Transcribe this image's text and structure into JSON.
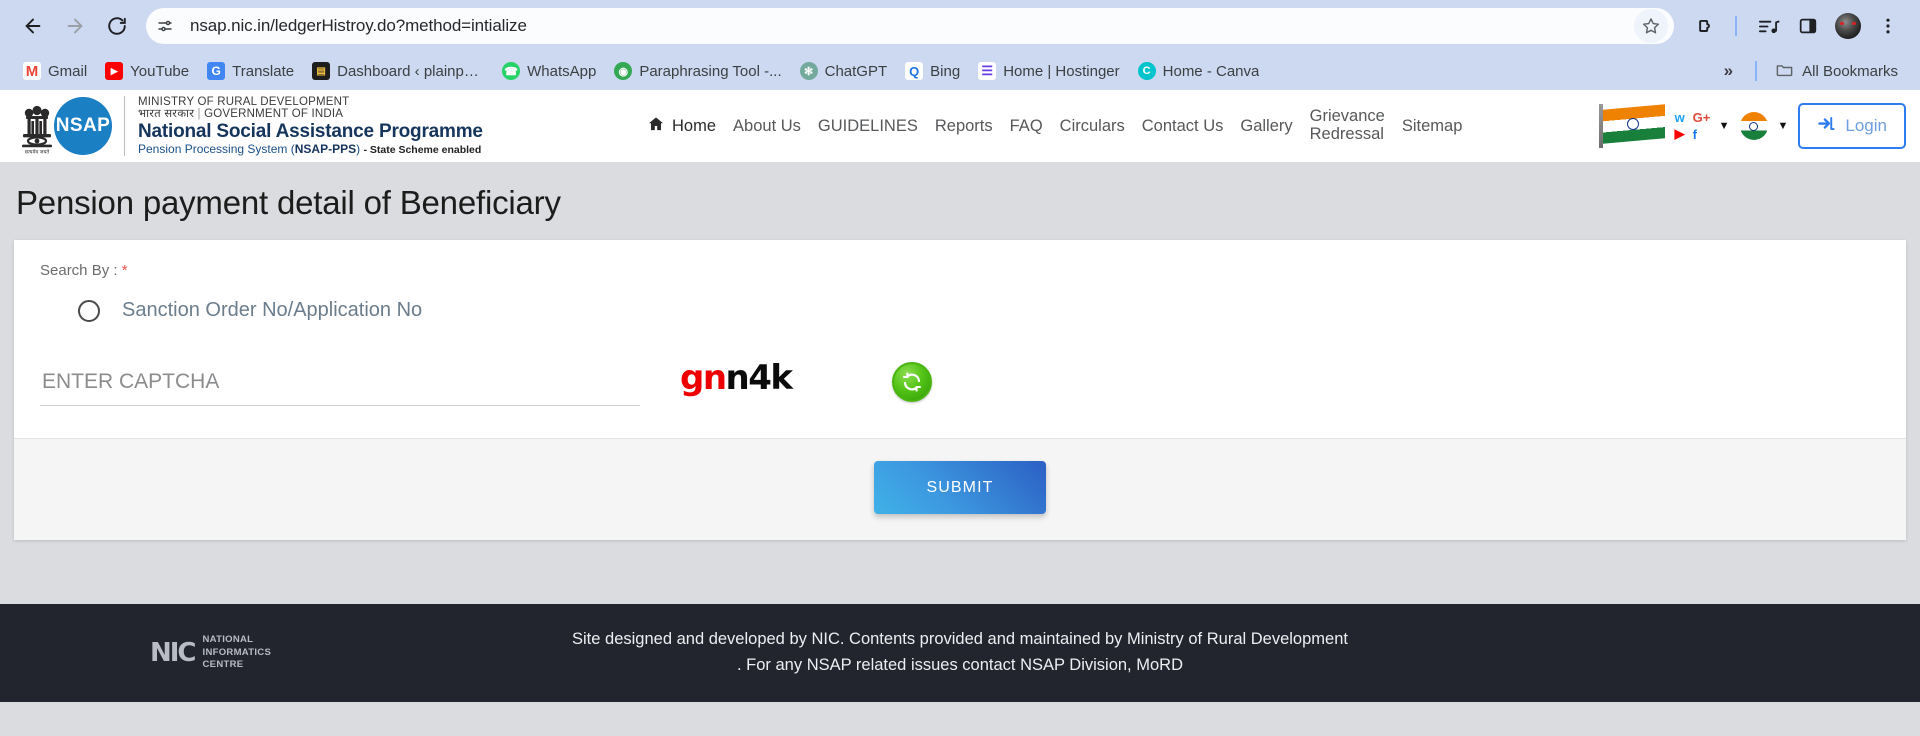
{
  "browser": {
    "back_label": "Back",
    "forward_label": "Forward",
    "reload_label": "Reload",
    "site_info_icon": "tune-icon",
    "url": "nsap.nic.in/ledgerHistroy.do?method=intialize",
    "star_icon": "star-icon",
    "extensions_icon": "extensions-puzzle-icon",
    "media_icon": "media-playlist-icon",
    "side_panel_icon": "side-panel-icon",
    "profile_icon": "profile-avatar",
    "menu_icon": "three-dot-menu-icon",
    "bookmarks": [
      {
        "label": "Gmail",
        "icon": "gmail-icon",
        "glyph": "M",
        "color": "#ea4335",
        "bg": "#ffffff"
      },
      {
        "label": "YouTube",
        "icon": "youtube-icon",
        "glyph": "▶",
        "color": "#ffffff",
        "bg": "#ff0000"
      },
      {
        "label": "Translate",
        "icon": "google-translate-icon",
        "glyph": "G",
        "color": "#ffffff",
        "bg": "#4285f4"
      },
      {
        "label": "Dashboard ‹ plainpa...",
        "icon": "wordpress-dashboard-icon",
        "glyph": "▤",
        "color": "#f0c040",
        "bg": "#1d1d1d"
      },
      {
        "label": "WhatsApp",
        "icon": "whatsapp-icon",
        "glyph": "✆",
        "color": "#ffffff",
        "bg": "#25d366"
      },
      {
        "label": "Paraphrasing Tool -...",
        "icon": "paraphrasing-tool-icon",
        "glyph": "◉",
        "color": "#ffffff",
        "bg": "#34a853"
      },
      {
        "label": "ChatGPT",
        "icon": "chatgpt-icon",
        "glyph": "✻",
        "color": "#ffffff",
        "bg": "#74aa9c"
      },
      {
        "label": "Bing",
        "icon": "bing-search-icon",
        "glyph": "Q",
        "color": "#1a73e8",
        "bg": "#ffffff"
      },
      {
        "label": "Home | Hostinger",
        "icon": "hostinger-icon",
        "glyph": "☰",
        "color": "#673de6",
        "bg": "#ffffff"
      },
      {
        "label": "Home - Canva",
        "icon": "canva-icon",
        "glyph": "C",
        "color": "#ffffff",
        "bg": "#00c4cc"
      }
    ],
    "overflow_label": "»",
    "all_bookmarks_label": "All Bookmarks",
    "all_bookmarks_icon": "folder-icon"
  },
  "site_header": {
    "emblem_icon": "india-national-emblem",
    "emblem_caption": "सत्यमेव जयते",
    "badge_text": "NSAP",
    "ministry_line": "MINISTRY OF RURAL DEVELOPMENT",
    "gov_line_hindi": "भारत सरकार",
    "gov_line_english": "GOVERNMENT OF INDIA",
    "programme_title": "National Social Assistance Programme",
    "subsystem_prefix": "Pension Processing System (",
    "subsystem_code": "NSAP-PPS",
    "subsystem_suffix": ")",
    "subsystem_tag": "- State Scheme enabled",
    "nav": [
      {
        "label": "Home",
        "icon": "home-icon",
        "active": true
      },
      {
        "label": "About Us"
      },
      {
        "label": "GUIDELINES"
      },
      {
        "label": "Reports"
      },
      {
        "label": "FAQ"
      },
      {
        "label": "Circulars"
      },
      {
        "label": "Contact Us"
      },
      {
        "label": "Gallery"
      },
      {
        "label": "Grievance Redressal",
        "line1": "Grievance",
        "line2": "Redressal"
      },
      {
        "label": "Sitemap"
      }
    ],
    "flag_icon": "indian-flag-waving",
    "social": [
      {
        "name": "twitter-icon",
        "glyph": "ᵛ"
      },
      {
        "name": "google-plus-icon",
        "glyph": "G+"
      },
      {
        "name": "youtube-icon",
        "glyph": "▶"
      },
      {
        "name": "facebook-icon",
        "glyph": "f"
      }
    ],
    "social_caret_icon": "caret-down-icon",
    "language_flag_icon": "india-flag-round-icon",
    "language_caret_icon": "caret-down-icon",
    "login_label": "Login",
    "login_icon": "login-arrow-icon",
    "accent_color": "#2e7df0"
  },
  "main": {
    "page_title": "Pension payment detail of Beneficiary",
    "search_by_label": "Search By :",
    "required_mark": "*",
    "radio": {
      "label": "Sanction Order No/Application No",
      "checked": false
    },
    "captcha": {
      "placeholder": "ENTER CAPTCHA",
      "required_mark": "*",
      "value": "",
      "image_text": "gnn4k",
      "image_text_red": "gn",
      "image_text_black": "n4k",
      "red_color": "#ee0000",
      "black_color": "#0b0b0b",
      "refresh_icon": "refresh-captcha-icon"
    },
    "submit_label": "SUBMIT"
  },
  "footer": {
    "nic_mark": "NIC",
    "nic_line1": "NATIONAL",
    "nic_line2": "INFORMATICS",
    "nic_line3": "CENTRE",
    "text_line1": "Site designed and developed by NIC. Contents provided and maintained by Ministry of Rural Development",
    "text_line2": ". For any NSAP related issues contact NSAP Division, MoRD"
  }
}
